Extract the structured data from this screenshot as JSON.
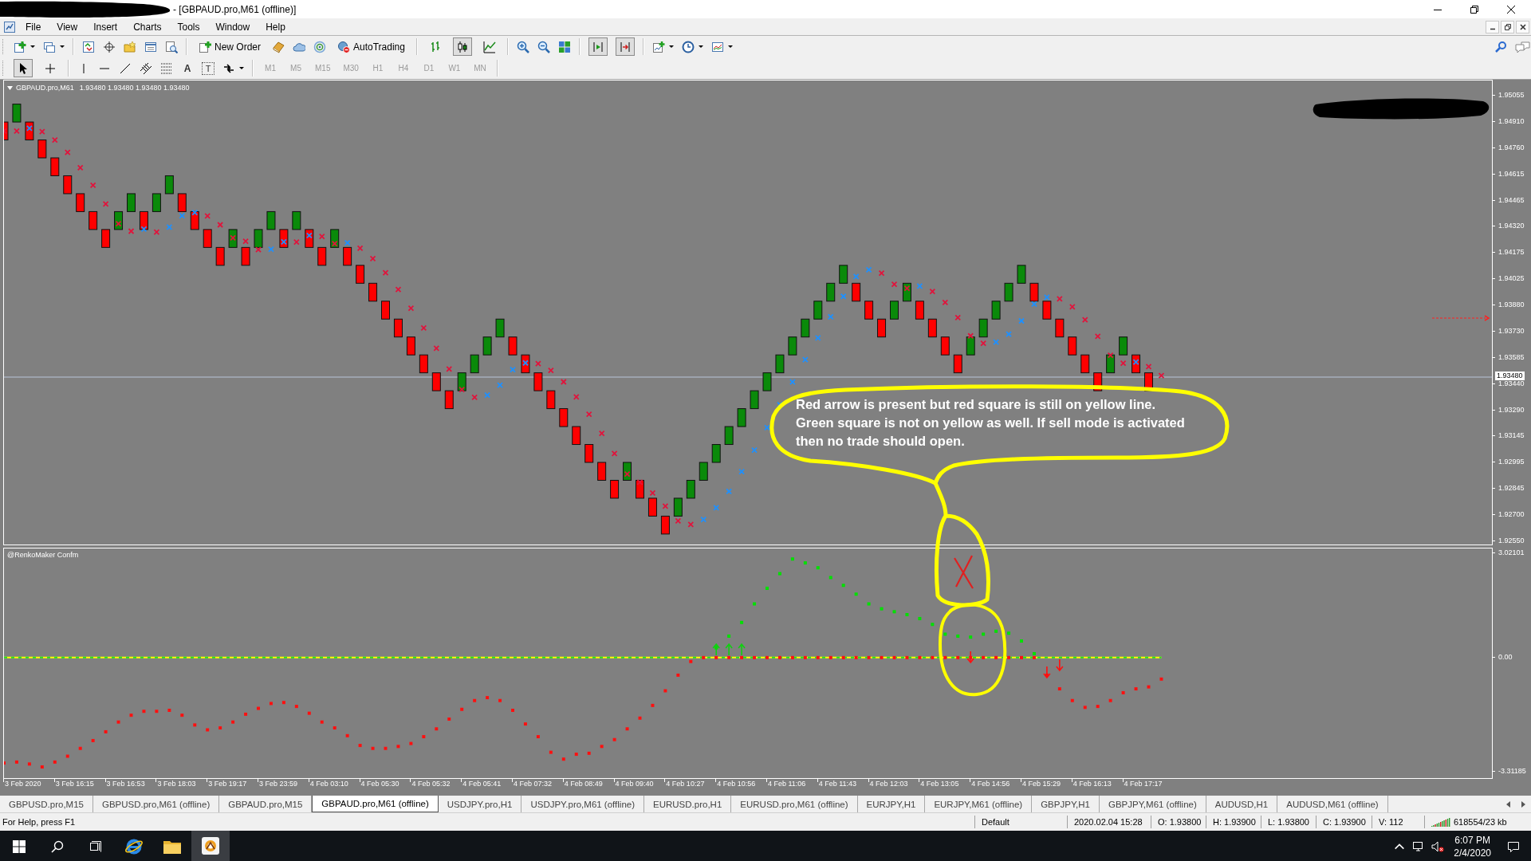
{
  "window": {
    "title": "- [GBPAUD.pro,M61 (offline)]"
  },
  "menu": [
    "File",
    "View",
    "Insert",
    "Charts",
    "Tools",
    "Window",
    "Help"
  ],
  "toolbar": {
    "new_order": "New Order",
    "autotrading": "AutoTrading",
    "chart_types": [
      {
        "selected": false
      },
      {
        "selected": true
      },
      {
        "selected": false
      }
    ],
    "chart_shift": {
      "on": true
    },
    "auto_scroll": {
      "on": true
    }
  },
  "drawing_toolbar": {
    "pointers": [
      {
        "selected": true
      },
      {
        "selected": false
      }
    ],
    "text_tool": "A",
    "label_tool": "T",
    "timeframes": [
      {
        "label": "M1",
        "disabled": true
      },
      {
        "label": "M5",
        "disabled": true
      },
      {
        "label": "M15",
        "disabled": true
      },
      {
        "label": "M30",
        "disabled": true
      },
      {
        "label": "H1",
        "disabled": true
      },
      {
        "label": "H4",
        "disabled": true
      },
      {
        "label": "D1",
        "disabled": true
      },
      {
        "label": "W1",
        "disabled": true
      },
      {
        "label": "MN",
        "disabled": true
      }
    ]
  },
  "chart": {
    "symbol": "GBPAUD.pro,M61",
    "ohlc": "1.93480 1.93480 1.93480 1.93480",
    "price_axis": [
      "1.95055",
      "1.94910",
      "1.94760",
      "1.94615",
      "1.94465",
      "1.94320",
      "1.94175",
      "1.94025",
      "1.93880",
      "1.93730",
      "1.93585",
      "1.93440",
      "1.93290",
      "1.93145",
      "1.92995",
      "1.92845",
      "1.92700",
      "1.92550"
    ],
    "current_price": "1.93480"
  },
  "indicator": {
    "name": "@RenkoMaker Confm",
    "axis": [
      "3.02101",
      "0.00",
      "-3.31185"
    ]
  },
  "time_axis": [
    "3 Feb 2020",
    "3 Feb 16:15",
    "3 Feb 16:53",
    "3 Feb 18:03",
    "3 Feb 19:17",
    "3 Feb 23:59",
    "4 Feb 03:10",
    "4 Feb 05:30",
    "4 Feb 05:32",
    "4 Feb 05:41",
    "4 Feb 07:32",
    "4 Feb 08:49",
    "4 Feb 09:40",
    "4 Feb 10:27",
    "4 Feb 10:56",
    "4 Feb 11:06",
    "4 Feb 11:43",
    "4 Feb 12:03",
    "4 Feb 13:05",
    "4 Feb 14:56",
    "4 Feb 15:29",
    "4 Feb 16:13",
    "4 Feb 17:17"
  ],
  "annotation": {
    "lines": [
      "Red arrow is present but red square is still on yellow line.",
      "Green square is not on yellow as well. If sell mode is activated",
      "then no trade should open."
    ]
  },
  "tabs": [
    {
      "label": "GBPUSD.pro,M15",
      "selected": false
    },
    {
      "label": "GBPUSD.pro,M61 (offline)",
      "selected": false
    },
    {
      "label": "GBPAUD.pro,M15",
      "selected": false
    },
    {
      "label": "GBPAUD.pro,M61 (offline)",
      "selected": true
    },
    {
      "label": "USDJPY.pro,H1",
      "selected": false
    },
    {
      "label": "USDJPY.pro,M61 (offline)",
      "selected": false
    },
    {
      "label": "EURUSD.pro,H1",
      "selected": false
    },
    {
      "label": "EURUSD.pro,M61 (offline)",
      "selected": false
    },
    {
      "label": "EURJPY,H1",
      "selected": false
    },
    {
      "label": "EURJPY,M61 (offline)",
      "selected": false
    },
    {
      "label": "GBPJPY,H1",
      "selected": false
    },
    {
      "label": "GBPJPY,M61 (offline)",
      "selected": false
    },
    {
      "label": "AUDUSD,H1",
      "selected": false
    },
    {
      "label": "AUDUSD,M61 (offline)",
      "selected": false
    }
  ],
  "status_bar": {
    "help": "For Help, press F1",
    "profile": "Default",
    "datetime": "2020.02.04 15:28",
    "open": "O: 1.93800",
    "high": "H: 1.93900",
    "low": "L: 1.93800",
    "close": "C: 1.93900",
    "volume": "V: 112",
    "traffic": "618554/23 kb"
  },
  "taskbar": {
    "apps": [
      {
        "selected": false
      },
      {
        "selected": false
      },
      {
        "selected": true
      }
    ],
    "time": "6:07 PM",
    "date": "2/4/2020"
  }
}
